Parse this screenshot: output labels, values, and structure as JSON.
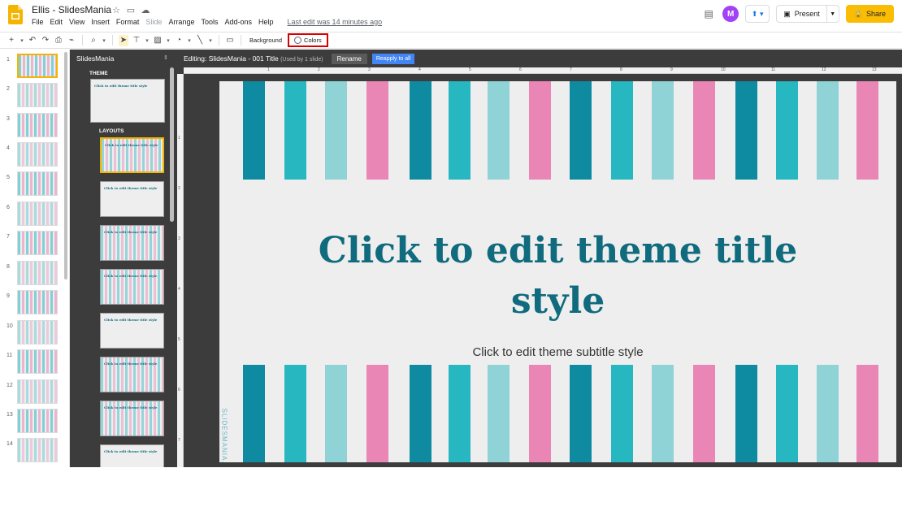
{
  "app": {
    "title": "Ellis - SlidesMania",
    "menu": [
      "File",
      "Edit",
      "View",
      "Insert",
      "Format",
      "Slide",
      "Arrange",
      "Tools",
      "Add-ons",
      "Help"
    ],
    "last_edit": "Last edit was 14 minutes ago",
    "present_label": "Present",
    "share_label": "Share",
    "avatar_letter": "M"
  },
  "toolbar": {
    "background_label": "Background",
    "colors_label": "Colors"
  },
  "filmstrip": {
    "slide_numbers": [
      "1",
      "2",
      "3",
      "4",
      "5",
      "6",
      "7",
      "8",
      "9",
      "10",
      "11",
      "12",
      "13",
      "14"
    ]
  },
  "master_panel": {
    "title": "SlidesMania",
    "theme_label": "THEME",
    "layouts_label": "LAYOUTS",
    "thumb_title": "Click to edit theme title style"
  },
  "edit_bar": {
    "editing_label": "Editing: SlidesMania - 001 Title",
    "used_by": "(Used by 1 slide)",
    "rename_label": "Rename",
    "reapply_label": "Reapply to all"
  },
  "ruler": {
    "h_numbers": [
      "1",
      "2",
      "3",
      "4",
      "5",
      "6",
      "7",
      "8",
      "9",
      "10",
      "11",
      "12",
      "13"
    ],
    "v_numbers": [
      "1",
      "2",
      "3",
      "4",
      "5",
      "6",
      "7"
    ]
  },
  "slide": {
    "title": "Click to edit theme title style",
    "subtitle": "Click to edit theme subtitle style",
    "vertical_brand": "SLIDESMANIA.COM",
    "colors": {
      "teal_dark": "#0e8ba0",
      "teal": "#27b7c0",
      "teal_light": "#8fd3d7",
      "pink": "#ea86b5",
      "title": "#0f6b7d"
    }
  },
  "colors": {
    "accent_yellow": "#fbbc04",
    "highlight_red": "#d50000",
    "selection_orange": "#f4b400",
    "reapply_blue": "#4285f4"
  }
}
